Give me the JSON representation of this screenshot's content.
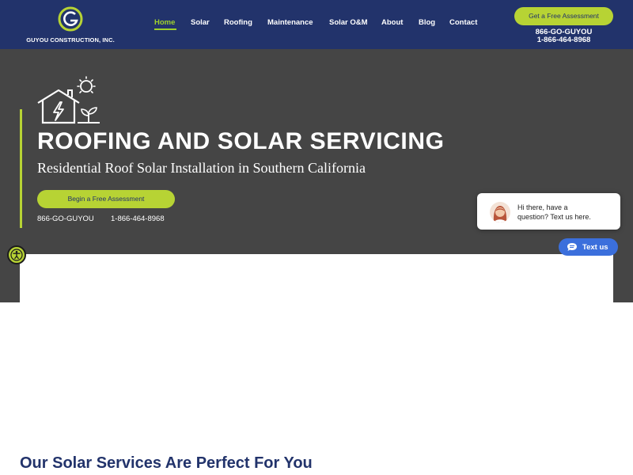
{
  "header": {
    "brand": "GUYOU CONSTRUCTION, INC.",
    "nav": [
      {
        "label": "Home",
        "active": true
      },
      {
        "label": "Solar"
      },
      {
        "label": "Roofing"
      },
      {
        "label": "Maintenance"
      },
      {
        "label": "Solar O&M"
      },
      {
        "label": "About"
      },
      {
        "label": "Blog"
      },
      {
        "label": "Contact"
      }
    ],
    "cta_label": "Get a Free Assessment",
    "phone_vanity": "866-GO-GUYOU",
    "phone_number": "1-866-464-8968"
  },
  "hero": {
    "icon": "house-solar-sun-icon",
    "title": "ROOFING AND SOLAR SERVICING",
    "subtitle": "Residential Roof Solar Installation in Southern California",
    "button_label": "Begin a Free Assessment",
    "phone_vanity": "866-GO-GUYOU",
    "phone_number": "1-866-464-8968"
  },
  "chat": {
    "message_line1": "Hi there, have a",
    "message_line2": "question? Text us here.",
    "button_label": "Text us"
  },
  "section": {
    "title": "Our Solar Services Are Perfect For You"
  },
  "colors": {
    "header_bg": "#22336b",
    "accent_green": "#b7d334",
    "hero_bg": "#454545",
    "chat_blue": "#3b6fdc"
  }
}
